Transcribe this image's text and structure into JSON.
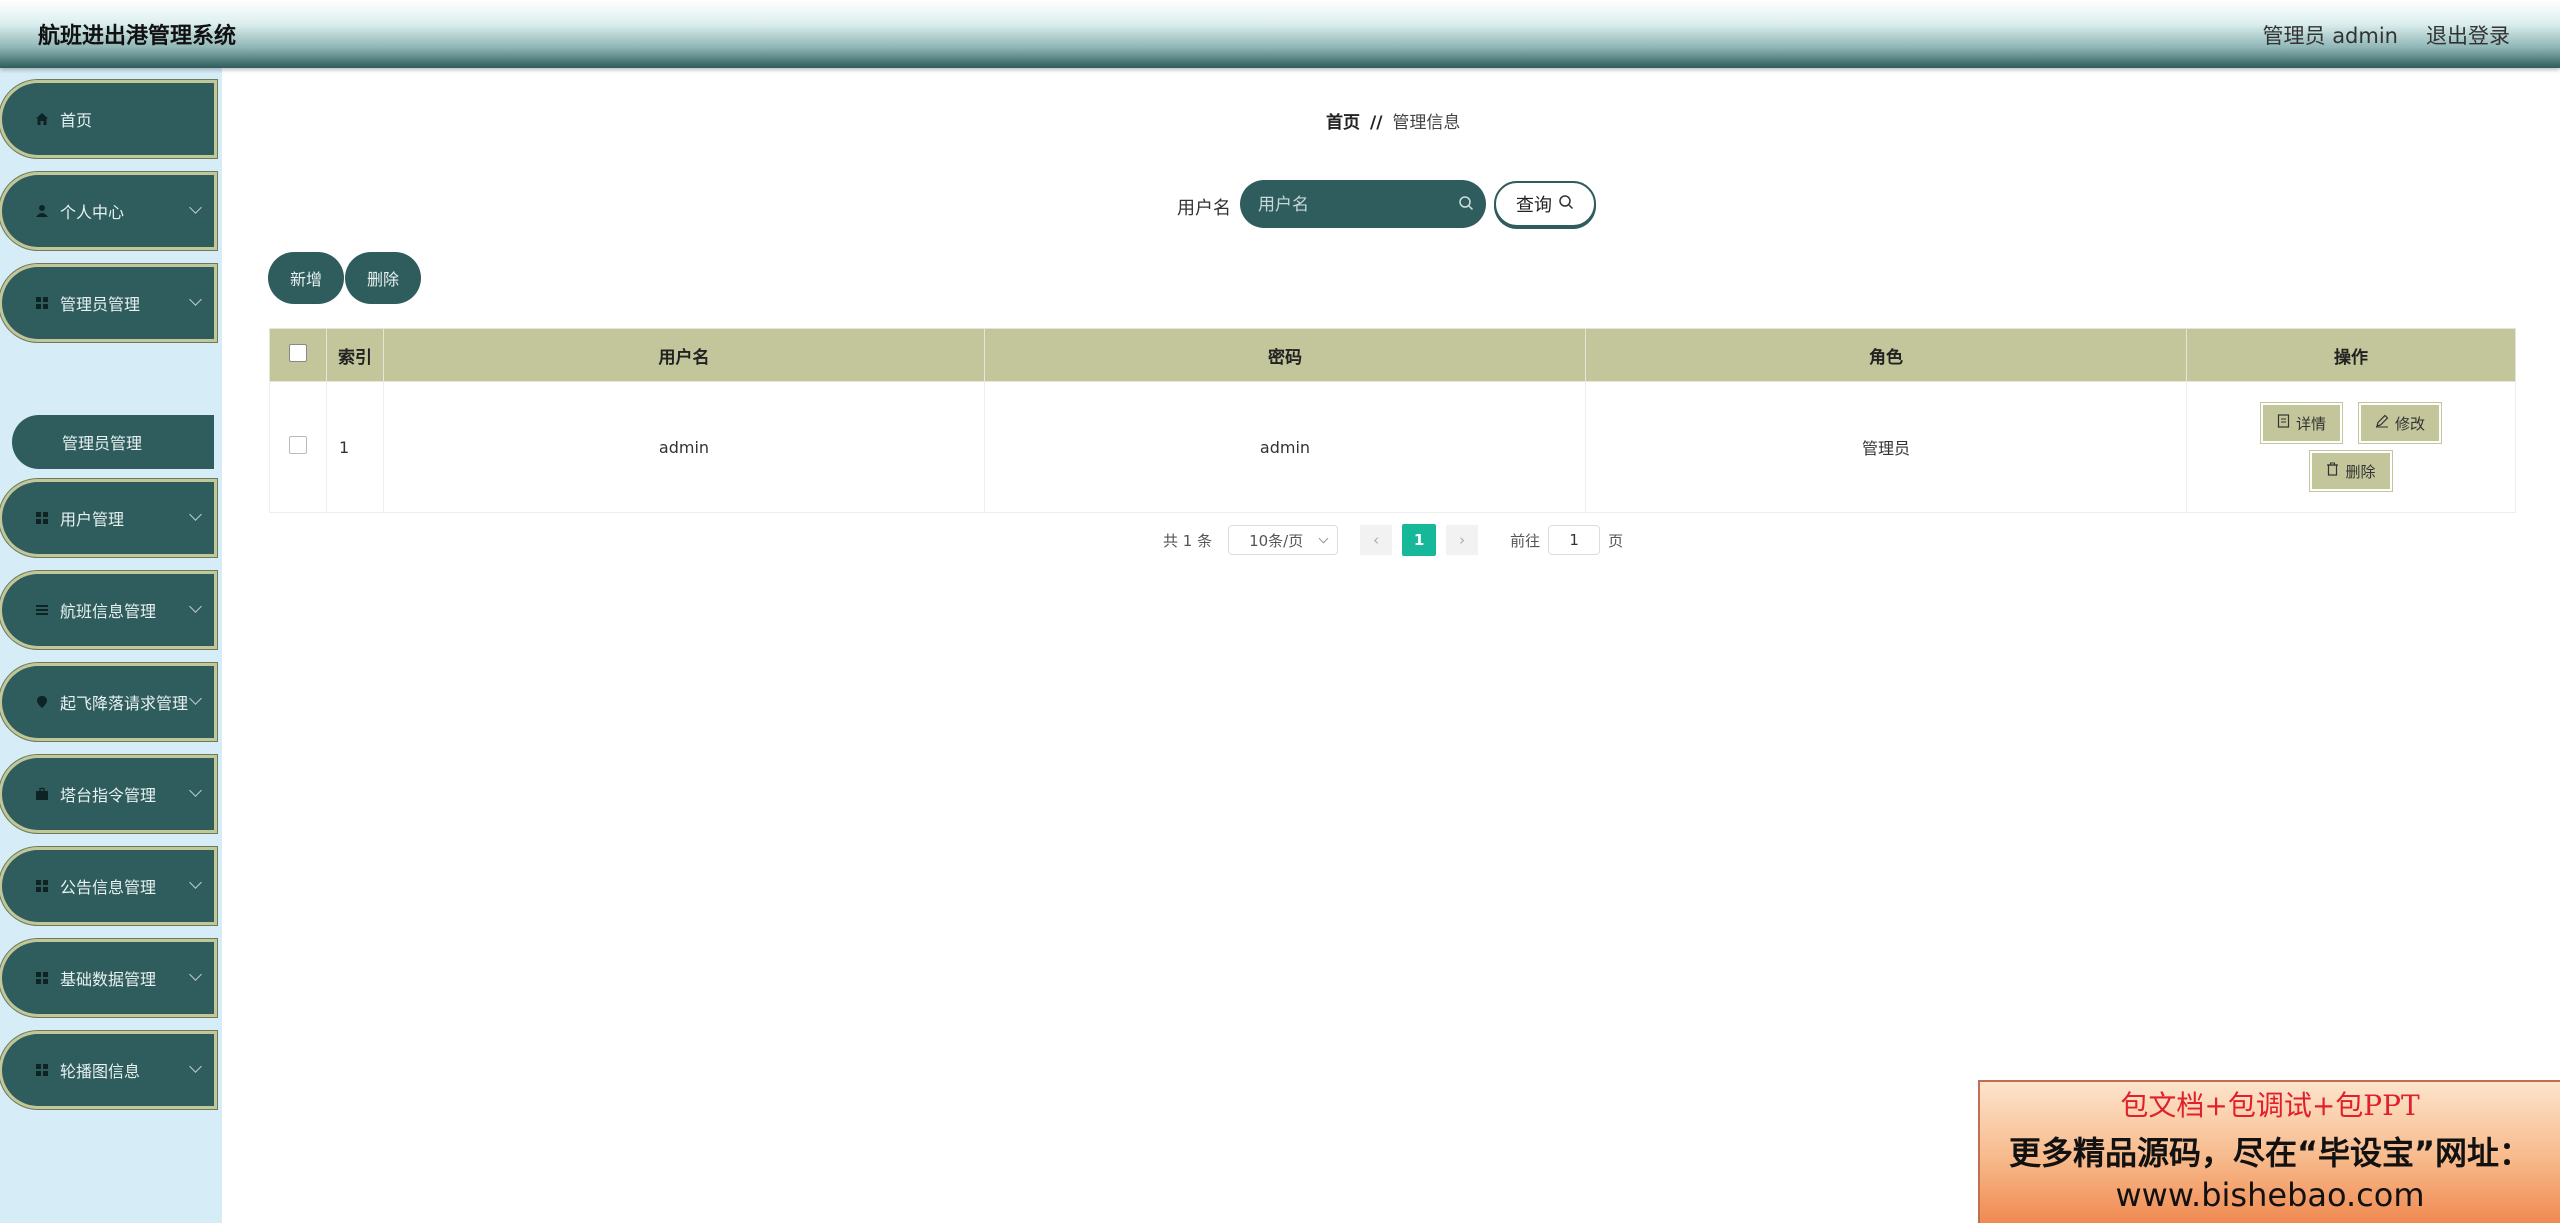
{
  "header": {
    "title": "航班进出港管理系统",
    "user_label": "管理员 admin",
    "logout_label": "退出登录"
  },
  "sidebar": {
    "items": [
      {
        "label": "首页",
        "icon": "home-icon"
      },
      {
        "label": "个人中心",
        "icon": "user-icon"
      },
      {
        "label": "管理员管理",
        "icon": "grid-icon"
      },
      {
        "label": "用户管理",
        "icon": "grid-icon"
      },
      {
        "label": "航班信息管理",
        "icon": "list-icon"
      },
      {
        "label": "起飞降落请求管理",
        "icon": "location-icon"
      },
      {
        "label": "塔台指令管理",
        "icon": "briefcase-icon"
      },
      {
        "label": "公告信息管理",
        "icon": "grid-icon"
      },
      {
        "label": "基础数据管理",
        "icon": "grid-icon"
      },
      {
        "label": "轮播图信息",
        "icon": "grid-icon"
      }
    ],
    "sub_item": "管理员管理"
  },
  "breadcrumb": {
    "home": "首页",
    "separator": "//",
    "current": "管理信息"
  },
  "search": {
    "label": "用户名",
    "placeholder": "用户名",
    "button_label": "查询"
  },
  "toolbar": {
    "add_label": "新增",
    "delete_label": "删除"
  },
  "table": {
    "columns": [
      "索引",
      "用户名",
      "密码",
      "角色",
      "操作"
    ],
    "rows": [
      {
        "index": "1",
        "username": "admin",
        "password": "admin",
        "role": "管理员"
      }
    ],
    "actions": {
      "detail": "详情",
      "edit": "修改",
      "delete": "删除"
    }
  },
  "pagination": {
    "total": "共 1 条",
    "page_size": "10条/页",
    "current_page": "1",
    "goto_label": "前往",
    "goto_value": "1",
    "page_unit": "页"
  },
  "ad": {
    "line1": "包文档+包调试+包PPT",
    "line2": "更多精品源码，尽在“毕设宝”网址：",
    "line3": "www.bishebao.com"
  },
  "colors": {
    "primary": "#2f5c5c",
    "table_header": "#c2c69a",
    "sidebar_bg": "#d6ecf6",
    "page_active": "#17b89a"
  }
}
